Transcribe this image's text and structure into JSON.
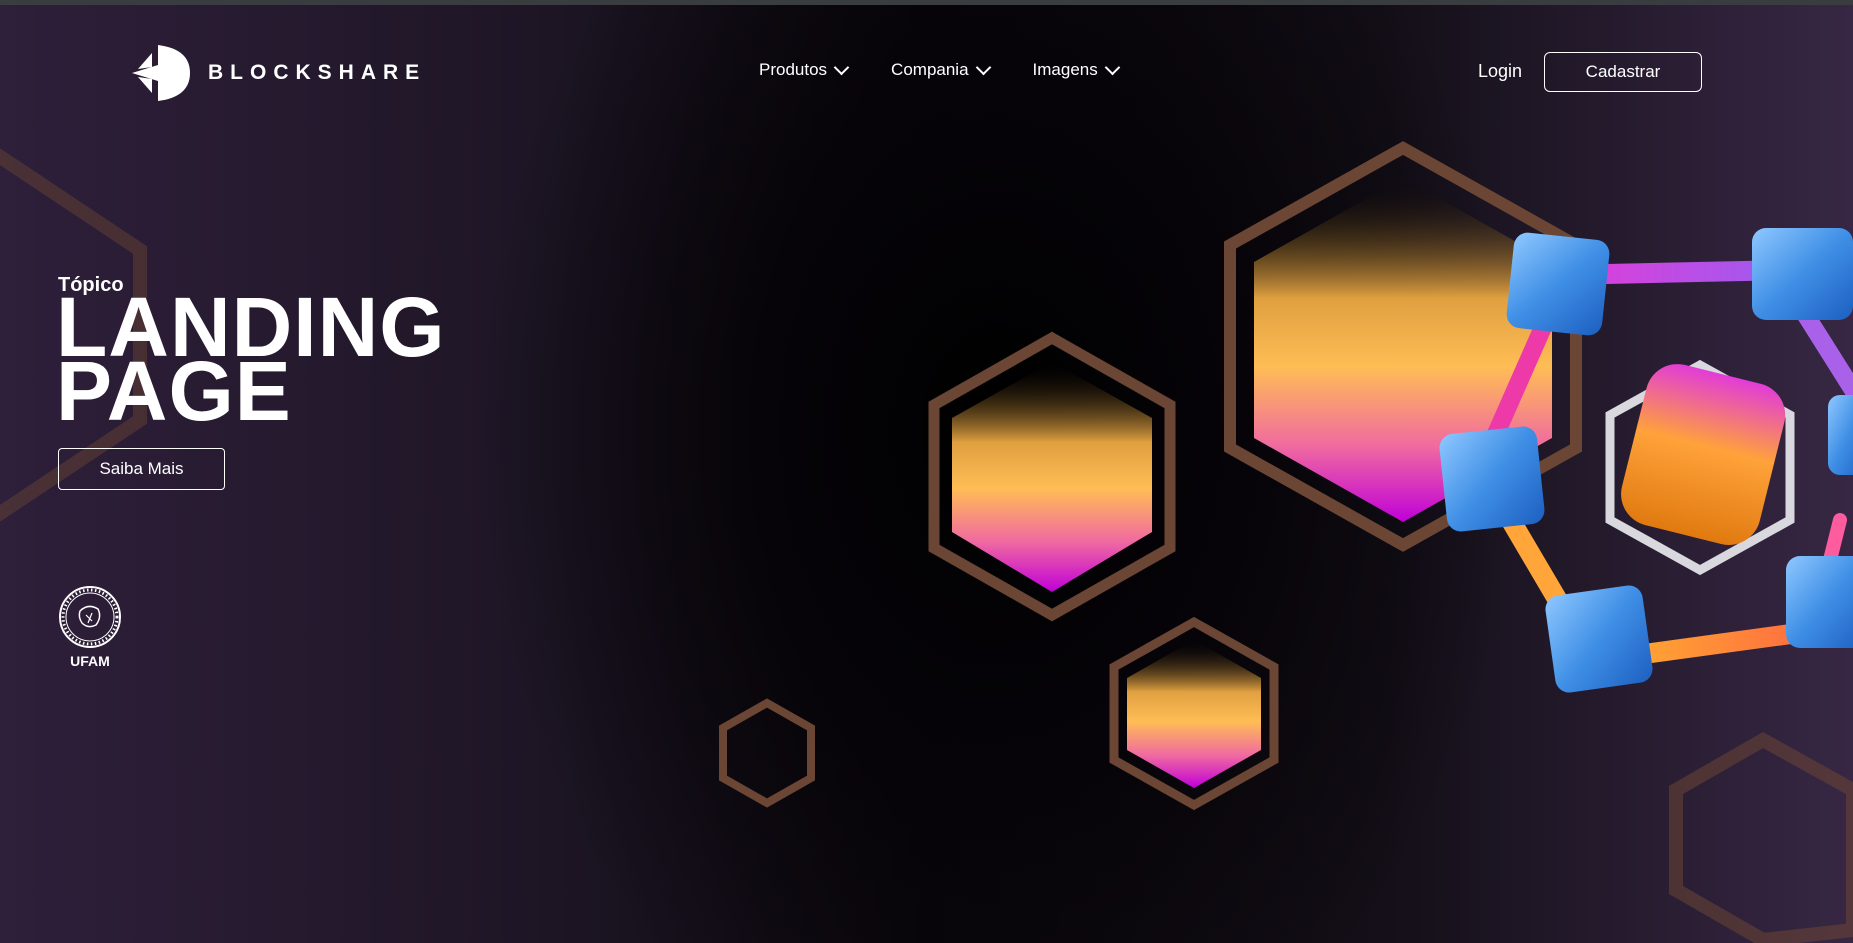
{
  "brand": {
    "name": "BLOCKSHARE",
    "logo_icon": "blockshare-logo-icon"
  },
  "nav": {
    "items": [
      {
        "label": "Produtos",
        "icon": "chevron-down-icon"
      },
      {
        "label": "Compania",
        "icon": "chevron-down-icon"
      },
      {
        "label": "Imagens",
        "icon": "chevron-down-icon"
      }
    ]
  },
  "auth": {
    "login_label": "Login",
    "signup_label": "Cadastrar"
  },
  "hero": {
    "topic": "Tópico",
    "title_line1": "LANDING",
    "title_line2": "PAGE",
    "cta_label": "Saiba Mais"
  },
  "partner": {
    "label": "UFAM",
    "icon": "ufam-seal-icon"
  },
  "colors": {
    "hex_outline": "#6b4634",
    "gradient_top": "#ffb648",
    "gradient_bottom": "#c400d8",
    "cube_blue": "#3f8fe6",
    "cube_orange": "#f59a1c",
    "link_pink": "#e236c6"
  }
}
